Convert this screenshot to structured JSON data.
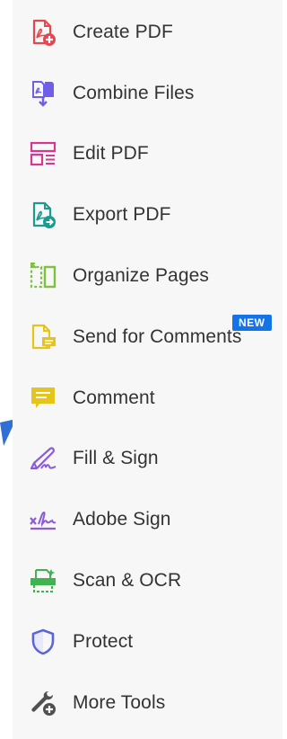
{
  "tools": [
    {
      "id": "create-pdf",
      "label": "Create PDF",
      "icon": "create-pdf-icon",
      "color": "#e34850"
    },
    {
      "id": "combine-files",
      "label": "Combine Files",
      "icon": "combine-files-icon",
      "color": "#6e5ee8"
    },
    {
      "id": "edit-pdf",
      "label": "Edit PDF",
      "icon": "edit-pdf-icon",
      "color": "#d83790"
    },
    {
      "id": "export-pdf",
      "label": "Export PDF",
      "icon": "export-pdf-icon",
      "color": "#1a9b8f"
    },
    {
      "id": "organize-pages",
      "label": "Organize Pages",
      "icon": "organize-pages-icon",
      "color": "#7ec13f"
    },
    {
      "id": "send-for-comments",
      "label": "Send for Comments",
      "icon": "send-for-comments-icon",
      "color": "#e6c419",
      "badge": "NEW"
    },
    {
      "id": "comment",
      "label": "Comment",
      "icon": "comment-icon",
      "color": "#e6c419"
    },
    {
      "id": "fill-sign",
      "label": "Fill & Sign",
      "icon": "fill-sign-icon",
      "color": "#8b5cd6"
    },
    {
      "id": "adobe-sign",
      "label": "Adobe Sign",
      "icon": "adobe-sign-icon",
      "color": "#8b5cd6"
    },
    {
      "id": "scan-ocr",
      "label": "Scan & OCR",
      "icon": "scan-ocr-icon",
      "color": "#3fb34f"
    },
    {
      "id": "protect",
      "label": "Protect",
      "icon": "shield-icon",
      "color": "#5b63d9"
    },
    {
      "id": "more-tools",
      "label": "More Tools",
      "icon": "more-tools-icon",
      "color": "#505050"
    }
  ],
  "colors": {
    "panel_background": "#f7f7f7",
    "text": "#333333",
    "badge_background": "#1473e6",
    "pointer_arrow": "#2f6fd6"
  }
}
